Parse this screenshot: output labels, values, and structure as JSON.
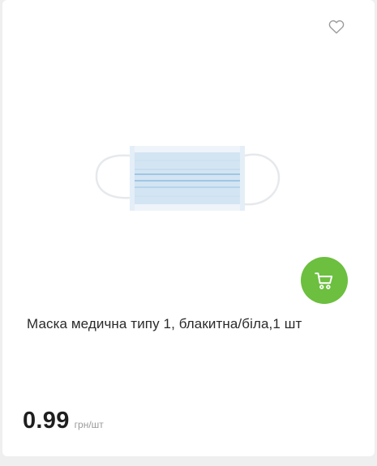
{
  "product": {
    "title": "Маска медична типу 1, блакитна/біла,1 шт",
    "price": "0.99",
    "unit": "грн/шт"
  },
  "icons": {
    "favorite": "heart-outline-icon",
    "cart": "shopping-cart-icon",
    "image": "medical-mask-image"
  },
  "colors": {
    "cart_button": "#6cbf3f",
    "mask": "#cfe3f3",
    "mask_stripe": "#8fbbe0"
  }
}
